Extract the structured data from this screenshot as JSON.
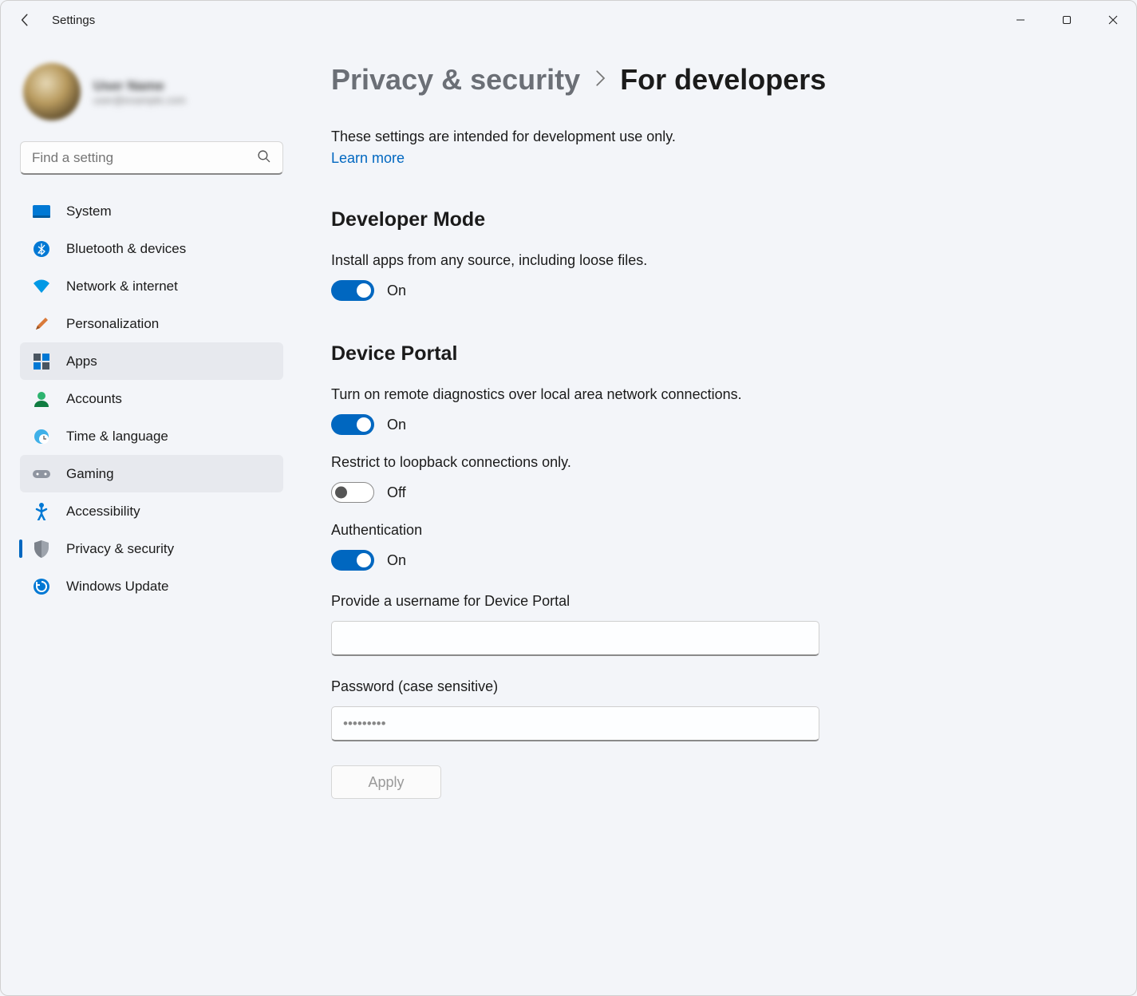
{
  "app": {
    "title": "Settings"
  },
  "profile": {
    "name": "User Name",
    "email": "user@example.com"
  },
  "search": {
    "placeholder": "Find a setting"
  },
  "sidebar": {
    "items": [
      {
        "label": "System"
      },
      {
        "label": "Bluetooth & devices"
      },
      {
        "label": "Network & internet"
      },
      {
        "label": "Personalization"
      },
      {
        "label": "Apps"
      },
      {
        "label": "Accounts"
      },
      {
        "label": "Time & language"
      },
      {
        "label": "Gaming"
      },
      {
        "label": "Accessibility"
      },
      {
        "label": "Privacy & security"
      },
      {
        "label": "Windows Update"
      }
    ]
  },
  "breadcrumb": {
    "parent": "Privacy & security",
    "current": "For developers"
  },
  "intro": {
    "text": "These settings are intended for development use only.",
    "link": "Learn more"
  },
  "dev_mode": {
    "heading": "Developer Mode",
    "desc": "Install apps from any source, including loose files.",
    "state": "On"
  },
  "device_portal": {
    "heading": "Device Portal",
    "remote_desc": "Turn on remote diagnostics over local area network connections.",
    "remote_state": "On",
    "loopback_desc": "Restrict to loopback connections only.",
    "loopback_state": "Off",
    "auth_desc": "Authentication",
    "auth_state": "On",
    "username_label": "Provide a username for Device Portal",
    "username_value": "",
    "password_label": "Password (case sensitive)",
    "password_value": "•••••••••",
    "apply": "Apply"
  }
}
